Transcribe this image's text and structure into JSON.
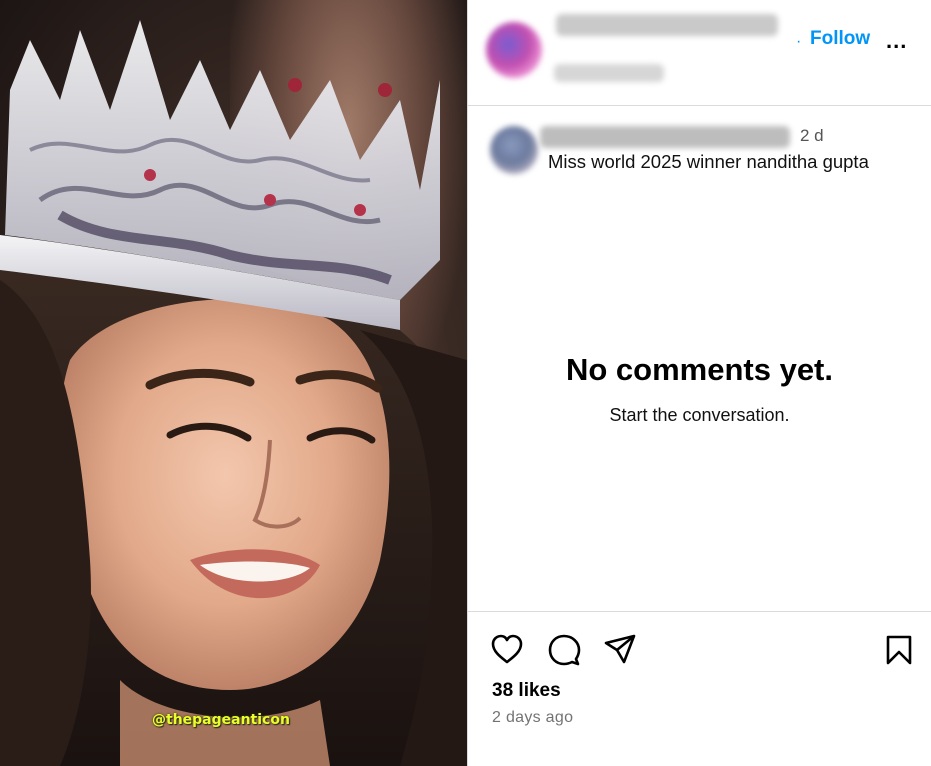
{
  "post": {
    "watermark": "@thepageanticon"
  },
  "header": {
    "follow_label": "Follow",
    "follow_separator": "·",
    "more_label": "..."
  },
  "caption": {
    "time": "2 d",
    "text": "Miss world 2025 winner nanditha gupta"
  },
  "comments": {
    "empty_title": "No comments yet.",
    "empty_subtitle": "Start the conversation."
  },
  "actions": {
    "icons": [
      "heart-icon",
      "comment-icon",
      "share-icon",
      "bookmark-icon"
    ],
    "likes": "38 likes",
    "posted": "2 days ago"
  },
  "colors": {
    "accent": "#0095f6",
    "divider": "#dbdbdb",
    "muted": "#737373",
    "watermark": "#e8ff2a"
  }
}
